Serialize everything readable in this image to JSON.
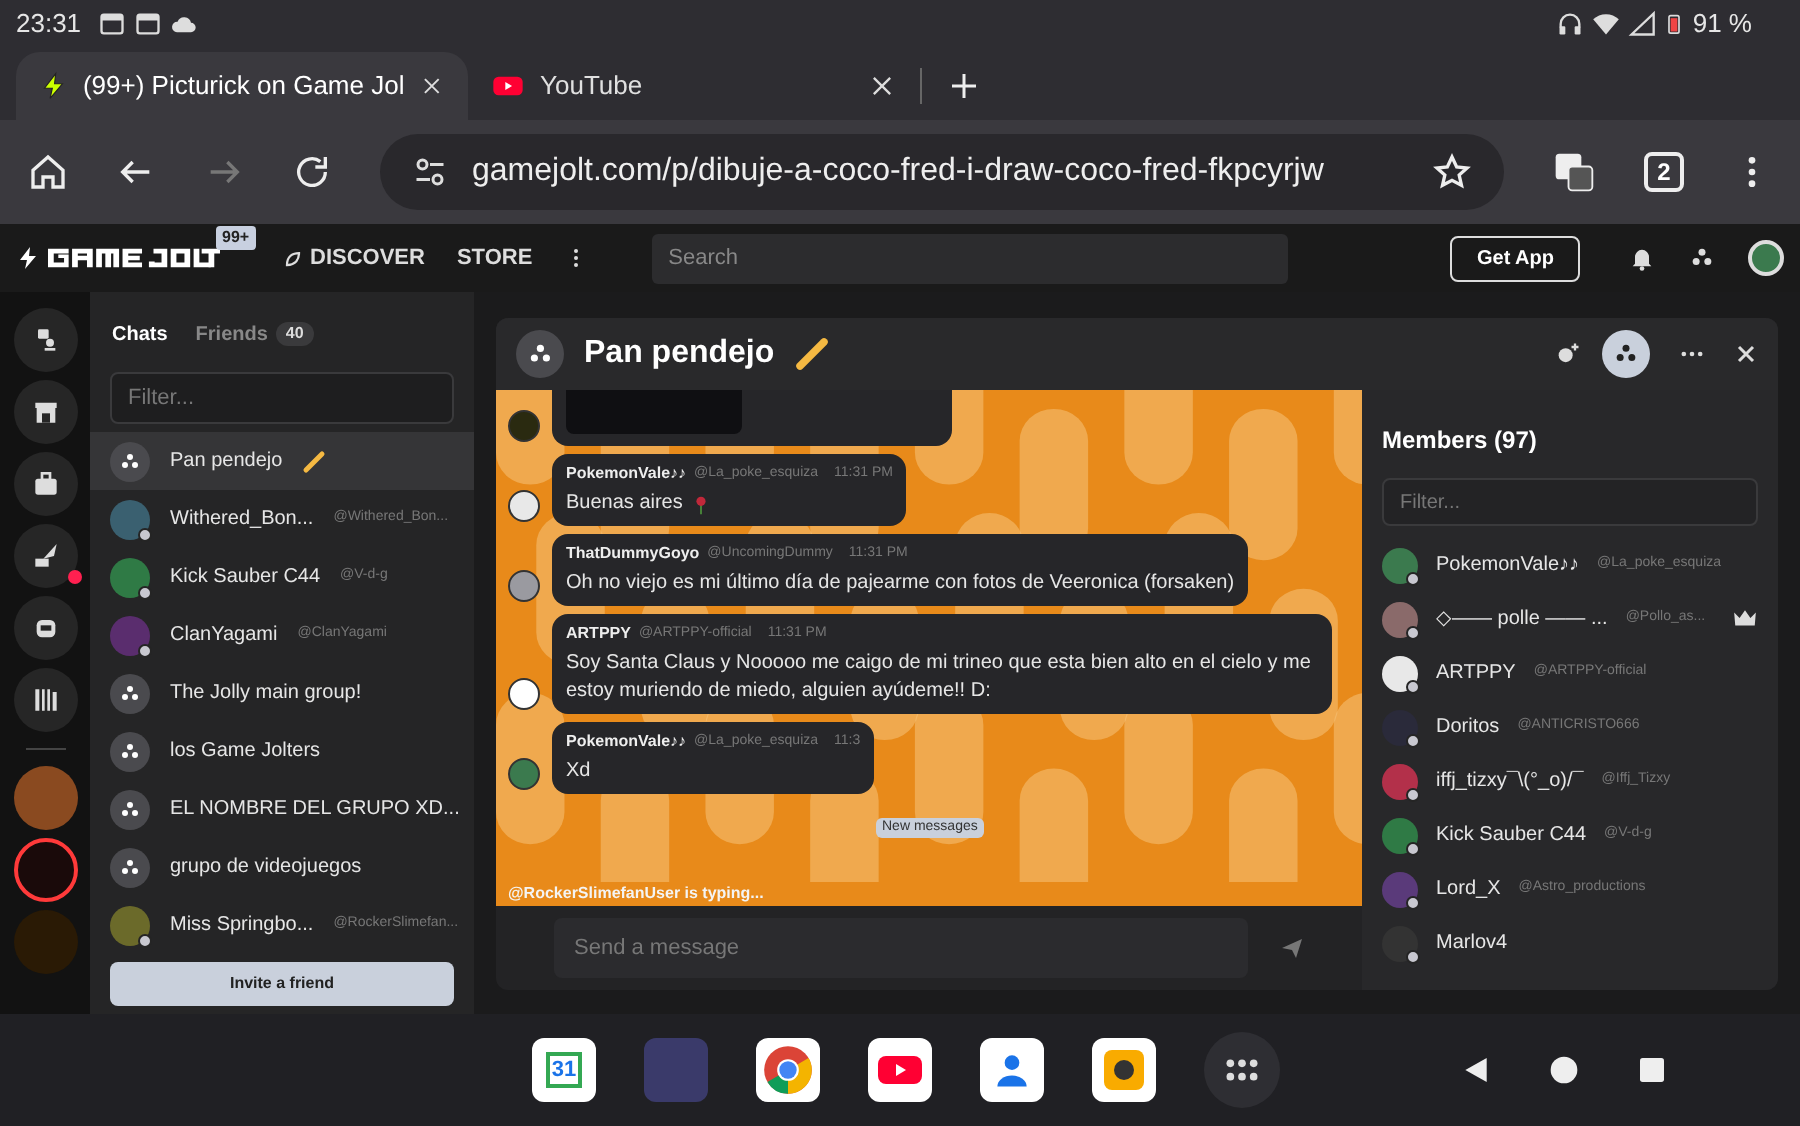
{
  "status_bar": {
    "time": "23:31",
    "battery": "91 %"
  },
  "browser_tabs": [
    {
      "kind": "gamejolt",
      "title": "(99+) Picturick on Game Jol",
      "selected": true
    },
    {
      "kind": "youtube",
      "title": "YouTube",
      "selected": false
    }
  ],
  "address_bar": {
    "url": "gamejolt.com/p/dibuje-a-coco-fred-i-draw-coco-fred-fkpcyrjw",
    "tab_count": "2"
  },
  "site_nav": {
    "logo_badge": "99+",
    "links": [
      "DISCOVER",
      "STORE"
    ],
    "search_placeholder": "Search",
    "get_app": "Get App"
  },
  "chat_sidebar": {
    "tabs": [
      {
        "label": "Chats",
        "selected": true
      },
      {
        "label": "Friends",
        "count": "40",
        "selected": false
      }
    ],
    "filter_placeholder": "Filter...",
    "chats": [
      {
        "kind": "group",
        "name": "Pan pendejo",
        "selected": true
      },
      {
        "kind": "user",
        "name": "Withered_Bon...",
        "handle": "@Withered_Bon...",
        "color": "#3a6070",
        "selected": false
      },
      {
        "kind": "user",
        "name": "Kick Sauber C44",
        "handle": "@V-d-g",
        "color": "#2f7a45",
        "selected": false
      },
      {
        "kind": "user",
        "name": "ClanYagami",
        "handle": "@ClanYagami",
        "color": "#5a2d6e",
        "selected": false
      },
      {
        "kind": "group",
        "name": "The Jolly main group!",
        "selected": false
      },
      {
        "kind": "group",
        "name": "los Game Jolters",
        "selected": false
      },
      {
        "kind": "group",
        "name": "EL NOMBRE DEL GRUPO XD...",
        "selected": false
      },
      {
        "kind": "group",
        "name": "grupo de videojuegos",
        "selected": false
      },
      {
        "kind": "user",
        "name": "Miss Springbo...",
        "handle": "@RockerSlimefan...",
        "color": "#6b6a2a",
        "selected": false
      }
    ],
    "invite_button": "Invite a friend"
  },
  "chat": {
    "title": "Pan pendejo",
    "messages": [
      {
        "kind": "image"
      },
      {
        "kind": "text",
        "author": "PokemonVale♪♪",
        "handle": "@La_poke_esquiza",
        "time": "11:31 PM",
        "text": "Buenas aires"
      },
      {
        "kind": "text",
        "author": "ThatDummyGoyo",
        "handle": "@UncomingDummy",
        "time": "11:31 PM",
        "text": "Oh no viejo es mi último día de pajearme con fotos de Veeronica (forsaken)"
      },
      {
        "kind": "text",
        "author": "ARTPPY",
        "handle": "@ARTPPY-official",
        "time": "11:31 PM",
        "text": "Soy Santa Claus y Nooooo me caigo de mi trineo que esta bien alto en el cielo y me estoy muriendo de miedo, alguien ayúdeme!! D:"
      },
      {
        "kind": "text",
        "author": "PokemonVale♪♪",
        "handle": "@La_poke_esquiza",
        "time": "11:3",
        "text": "Xd"
      }
    ],
    "typing": "@RockerSlimefanUser is typing...",
    "new_messages": "New messages",
    "input_placeholder": "Send a message"
  },
  "members": {
    "title": "Members (97)",
    "filter_placeholder": "Filter...",
    "list": [
      {
        "name": "PokemonVale♪♪",
        "handle": "@La_poke_esquiza",
        "color": "#3b7a4e",
        "owner": false
      },
      {
        "name": "◇—— polle —— ...",
        "handle": "@Pollo_as...",
        "color": "#8a6a6a",
        "owner": true
      },
      {
        "name": "ARTPPY",
        "handle": "@ARTPPY-official",
        "color": "#e8e8e8",
        "owner": false
      },
      {
        "name": "Doritos",
        "handle": "@ANTICRISTO666",
        "color": "#2a2a3a",
        "owner": false
      },
      {
        "name": "iffj_tizxy¯\\(°_o)/¯",
        "handle": "@Iffj_Tizxy",
        "color": "#b3304a",
        "owner": false
      },
      {
        "name": "Kick Sauber C44",
        "handle": "@V-d-g",
        "color": "#2f7a45",
        "owner": false
      },
      {
        "name": "Lord_X",
        "handle": "@Astro_productions",
        "color": "#5a3a7a",
        "owner": false
      },
      {
        "name": "Marlov4",
        "color": "#333333",
        "owner": false
      }
    ]
  },
  "dock": [
    {
      "kind": "calendar",
      "label": "31"
    },
    {
      "kind": "photo"
    },
    {
      "kind": "chrome"
    },
    {
      "kind": "youtube"
    },
    {
      "kind": "contacts"
    },
    {
      "kind": "camera"
    },
    {
      "kind": "apps"
    }
  ]
}
